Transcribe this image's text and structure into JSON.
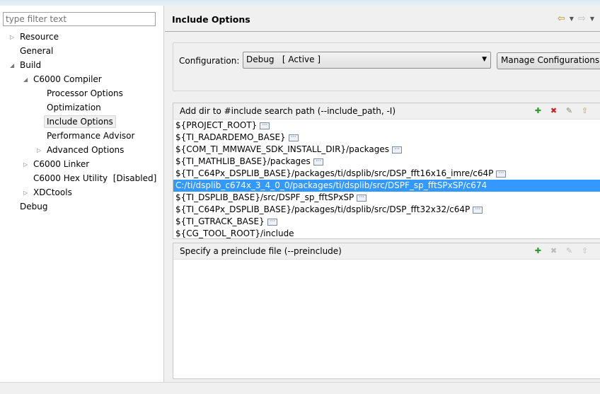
{
  "filter": {
    "placeholder": "type filter text"
  },
  "tree": [
    {
      "label": "Resource",
      "toggle": "▷"
    },
    {
      "label": "General",
      "toggle": ""
    },
    {
      "label": "Build",
      "toggle": "◢"
    },
    {
      "label": "C6000 Compiler",
      "toggle": "◢"
    },
    {
      "label": "Processor Options",
      "toggle": ""
    },
    {
      "label": "Optimization",
      "toggle": ""
    },
    {
      "label": "Include Options",
      "toggle": "",
      "selected": true
    },
    {
      "label": "Performance Advisor",
      "toggle": ""
    },
    {
      "label": "Advanced Options",
      "toggle": "▷"
    },
    {
      "label": "C6000 Linker",
      "toggle": "▷"
    },
    {
      "label": "C6000 Hex Utility  [Disabled]",
      "toggle": ""
    },
    {
      "label": "XDCtools",
      "toggle": "▷"
    },
    {
      "label": "Debug",
      "toggle": ""
    }
  ],
  "header": {
    "title": "Include Options",
    "back_icon": "⇦",
    "forward_icon": "⇨",
    "dropdown_icon": "▼"
  },
  "config": {
    "label": "Configuration:",
    "value": "Debug   [ Active ]",
    "manage_label": "Manage Configurations..."
  },
  "include_path": {
    "title": "Add dir to #include search path (--include_path, -I)",
    "items": [
      "${PROJECT_ROOT}",
      "${TI_RADARDEMO_BASE}",
      "${COM_TI_MMWAVE_SDK_INSTALL_DIR}/packages",
      "${TI_MATHLIB_BASE}/packages",
      "${TI_C64Px_DSPLIB_BASE}/packages/ti/dsplib/src/DSP_fft16x16_imre/c64P",
      "C:/ti/dsplib_c674x_3_4_0_0/packages/ti/dsplib/src/DSPF_sp_fftSPxSP/c674",
      "${TI_DSPLIB_BASE}/src/DSPF_sp_fftSPxSP",
      "${TI_C64Px_DSPLIB_BASE}/packages/ti/dsplib/src/DSP_fft32x32/c64P",
      "${TI_GTRACK_BASE}",
      "${CG_TOOL_ROOT}/include"
    ],
    "selected_index": 5
  },
  "preinclude": {
    "title": "Specify a preinclude file (--preinclude)",
    "items": []
  },
  "colors": {
    "selection": "#3399ff",
    "add": "#2a9a2a",
    "delete": "#d02020"
  }
}
